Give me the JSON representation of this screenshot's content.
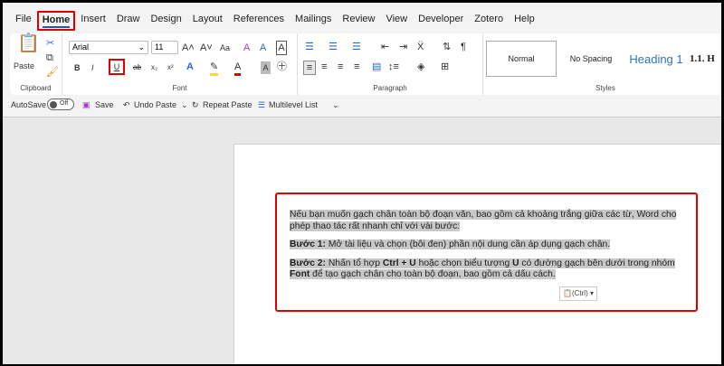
{
  "tabs": [
    "File",
    "Home",
    "Insert",
    "Draw",
    "Design",
    "Layout",
    "References",
    "Mailings",
    "Review",
    "View",
    "Developer",
    "Zotero",
    "Help"
  ],
  "clipboard": {
    "paste": "Paste",
    "label": "Clipboard"
  },
  "font": {
    "name": "Arial",
    "size": "11",
    "label": "Font",
    "case": "Aa",
    "bold": "B",
    "italic": "I",
    "underline": "U",
    "sub": "x₂",
    "sup": "x²"
  },
  "paragraph": {
    "label": "Paragraph"
  },
  "styles": {
    "label": "Styles",
    "items": [
      "Normal",
      "No Spacing",
      "Heading 1",
      "1.1. H"
    ]
  },
  "qat": {
    "autosave": "AutoSave",
    "toggle": "Off",
    "save": "Save",
    "undo": "Undo Paste",
    "repeat": "Repeat Paste",
    "multilevel": "Multilevel List"
  },
  "document": {
    "p1": "Nếu bạn muốn gạch chân toàn bộ đoạn văn, bao gồm cả khoảng trắng giữa các từ, Word cho phép thao tác rất nhanh chỉ với vài bước:",
    "p2_bold": "Bước 1:",
    "p2": " Mở tài liệu và chọn (bôi đen) phần nội dung cần áp dụng gạch chân.",
    "p3_bold": "Bước 2:",
    "p3a": " Nhấn tổ hợp ",
    "p3_ctrl": "Ctrl + U",
    "p3b": " hoặc chọn biểu tượng ",
    "p3_u": "U",
    "p3c": " có đường gạch bên dưới trong nhóm ",
    "p3_font": "Font",
    "p3d": " để tạo gạch chân cho toàn bộ đoạn, bao gồm cả dấu cách."
  },
  "paste_options": "(Ctrl)",
  "colors": {
    "highlight_box": "#e00000",
    "accent": "#185abd",
    "selection": "#c8c8c8"
  }
}
